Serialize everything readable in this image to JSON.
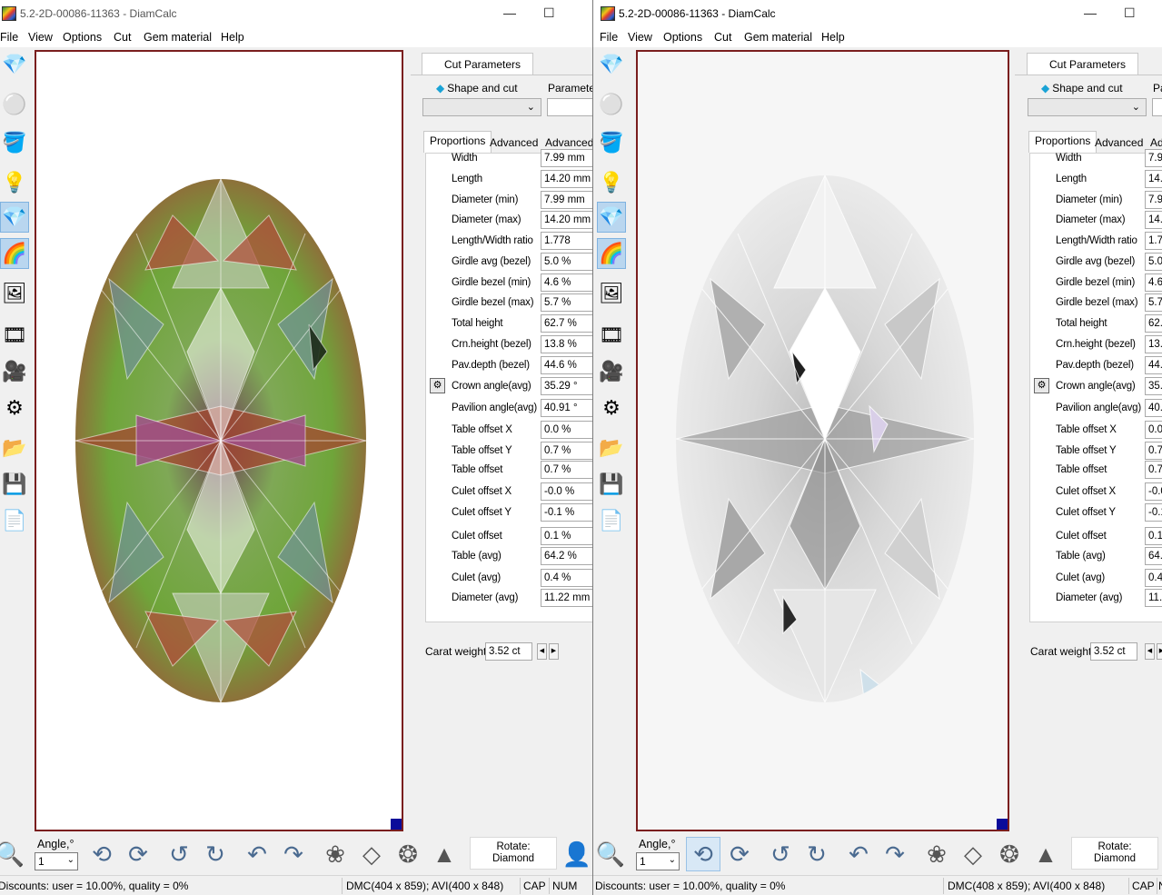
{
  "left_window": {
    "title": "5.2-2D-00086-11363 - DiamCalc",
    "menu": [
      "File",
      "View",
      "Options",
      "Cut",
      "Gem material",
      "Help"
    ],
    "panel": {
      "main_tab": "Cut Parameters",
      "shape_label": "Shape and cut",
      "param_label": "Parameter",
      "subtabs": [
        "Proportions",
        "Advanced",
        "Advanced"
      ],
      "values": [
        "7.99 mm",
        "14.20 mm",
        "7.99 mm",
        "14.20 mm",
        "1.778",
        "5.0 %",
        "4.6 %",
        "5.7 %",
        "62.7 %",
        "13.8 %",
        "44.6 %",
        "35.29 °",
        "40.91 °",
        "0.0 %",
        "0.7 %",
        "0.7 %",
        "-0.0 %",
        "-0.1 %",
        "0.1 %",
        "64.2 %",
        "0.4 %",
        "11.22 mm"
      ],
      "carat_label": "Carat weight",
      "carat_value": "3.52 ct"
    },
    "bottom": {
      "angle_label": "Angle,°",
      "angle_value": "1",
      "rotate_label": "Rotate:",
      "rotate_value": "Diamond"
    },
    "status": {
      "discounts": "Discounts: user = 10.00%, quality = 0%",
      "dmc": "DMC(404 x 859); AVI(400 x 848)",
      "cap": "CAP",
      "num": "NUM"
    }
  },
  "right_window": {
    "title": "5.2-2D-00086-11363 - DiamCalc",
    "menu": [
      "File",
      "View",
      "Options",
      "Cut",
      "Gem material",
      "Help"
    ],
    "panel": {
      "main_tab": "Cut Parameters",
      "shape_label": "Shape and cut",
      "param_label": "Pa",
      "subtabs": [
        "Proportions",
        "Advanced",
        "Adv"
      ],
      "values": [
        "7.9",
        "14.",
        "7.9",
        "14.",
        "1.7",
        "5.0",
        "4.6",
        "5.7",
        "62.",
        "13.",
        "44.",
        "35.",
        "40.",
        "0.0",
        "0.7",
        "0.7",
        "-0.0",
        "-0.1",
        "0.1",
        "64.",
        "0.4",
        "11."
      ],
      "carat_label": "Carat weight",
      "carat_value": "3.52 ct"
    },
    "bottom": {
      "angle_label": "Angle,°",
      "angle_value": "1",
      "rotate_label": "Rotate:",
      "rotate_value": "Diamond"
    },
    "status": {
      "discounts": "Discounts: user = 10.00%, quality = 0%",
      "dmc": "DMC(408 x 859); AVI(400 x 848)",
      "cap": "CAP",
      "num": "N"
    }
  },
  "prop_labels": [
    "Width",
    "Length",
    "Diameter (min)",
    "Diameter (max)",
    "Length/Width ratio",
    "Girdle avg (bezel)",
    "Girdle bezel (min)",
    "Girdle bezel (max)",
    "Total height",
    "Crn.height (bezel)",
    "Pav.depth (bezel)",
    "Crown angle(avg)",
    "Pavilion angle(avg)",
    "Table offset X",
    "Table offset Y",
    "Table offset",
    "Culet offset X",
    "Culet offset Y",
    "Culet offset",
    "Table (avg)",
    "Culet (avg)",
    "Diameter (avg)"
  ],
  "colors": {
    "view_border": "#7a1e1e",
    "corner_marker": "#0b0b9a",
    "selected_tool": "#b9d6ef",
    "gem_green": "#6fa53a",
    "gem_red": "#a4452f",
    "gem_magenta": "#a0508a"
  }
}
